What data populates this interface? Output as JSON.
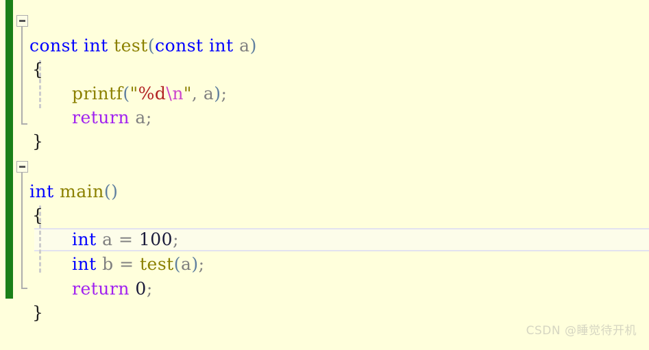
{
  "editor": {
    "background_color": "#ffffdc",
    "current_line_highlight_color": "#fdfdea",
    "change_bar_color": "#1a8018",
    "language": "C"
  },
  "code": {
    "lines": [
      {
        "n": 1,
        "text": "const int test(const int a)",
        "folded": false,
        "has_fold_box": true
      },
      {
        "n": 2,
        "text": "{"
      },
      {
        "n": 3,
        "text": "    printf(\"%d\\n\", a);"
      },
      {
        "n": 4,
        "text": "    return a;"
      },
      {
        "n": 5,
        "text": "}"
      },
      {
        "n": 6,
        "text": ""
      },
      {
        "n": 7,
        "text": "int main()",
        "has_fold_box": true
      },
      {
        "n": 8,
        "text": "{"
      },
      {
        "n": 9,
        "text": "    int a = 100;"
      },
      {
        "n": 10,
        "text": "    int b = test(a);",
        "current": true
      },
      {
        "n": 11,
        "text": "    return 0;"
      },
      {
        "n": 12,
        "text": "}"
      }
    ],
    "tokens": {
      "kw_const": "const",
      "kw_int": "int",
      "fn_test": "test",
      "fn_printf": "printf",
      "fn_main": "main",
      "ctl_return": "return",
      "id_a": "a",
      "id_b": "b",
      "num_100": "100",
      "num_0": "0",
      "str_quote": "\"",
      "str_percent_d": "%d",
      "str_newline": "\\n",
      "brace_open": "{",
      "brace_close": "}",
      "paren_open": "(",
      "paren_close": ")",
      "semicolon": ";",
      "comma": ",",
      "assign": "=",
      "space": " "
    }
  },
  "fold_markers": {
    "glyph": "minus",
    "label": "collapse-block"
  },
  "watermark": {
    "text": "CSDN @睡觉待开机",
    "color": "#d6d6c2"
  }
}
